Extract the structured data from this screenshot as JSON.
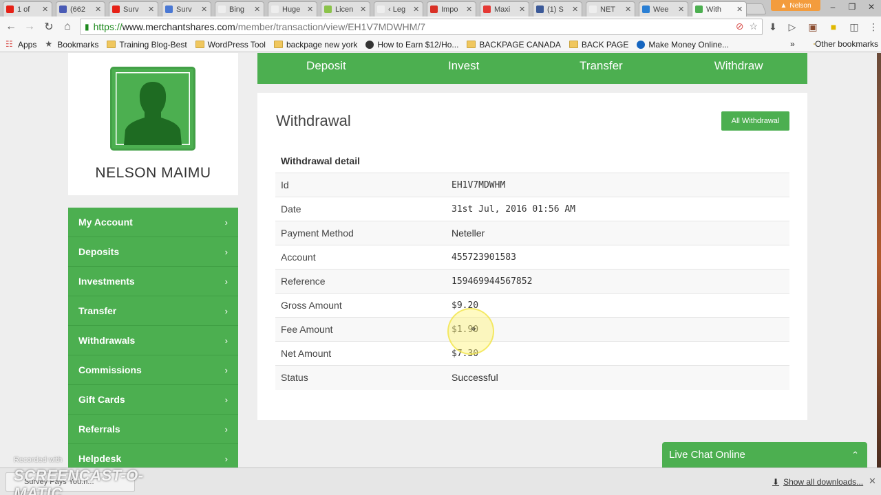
{
  "browser": {
    "tabs": [
      {
        "label": "1 of",
        "color": "#e62117"
      },
      {
        "label": "(662",
        "color": "#4a5bb5"
      },
      {
        "label": "Surv",
        "color": "#e62117"
      },
      {
        "label": "Surv",
        "color": "#4a78d4"
      },
      {
        "label": "Bing",
        "color": "#eeeeee"
      },
      {
        "label": "Huge",
        "color": "#eeeeee"
      },
      {
        "label": "Licen",
        "color": "#8bc34a"
      },
      {
        "label": "‹ Leg",
        "color": "#eeeeee"
      },
      {
        "label": "Impo",
        "color": "#d93025"
      },
      {
        "label": "Maxi",
        "color": "#e53935"
      },
      {
        "label": "(1) S",
        "color": "#3b5998"
      },
      {
        "label": "NET",
        "color": "#eeeeee"
      },
      {
        "label": "Wee",
        "color": "#2a7fd4"
      },
      {
        "label": "With",
        "color": "#4caf50"
      }
    ],
    "profile_name": "Nelson",
    "url": {
      "scheme": "https://",
      "host": "www.merchantshares.com",
      "path": "/member/transaction/view/EH1V7MDWHM/7"
    },
    "bookmarks": [
      {
        "label": "Apps",
        "icon": "apps-grid-icon"
      },
      {
        "label": "Bookmarks",
        "icon": "star-icon"
      },
      {
        "label": "Training Blog-Best",
        "icon": "folder-icon"
      },
      {
        "label": "WordPress Tool",
        "icon": "folder-icon"
      },
      {
        "label": "backpage new york",
        "icon": "folder-icon"
      },
      {
        "label": "How to Earn $12/Ho...",
        "icon": "site-icon"
      },
      {
        "label": "BACKPAGE CANADA",
        "icon": "folder-icon"
      },
      {
        "label": "BACK PAGE",
        "icon": "folder-icon"
      },
      {
        "label": "Make Money Online...",
        "icon": "site-icon"
      }
    ],
    "other_bookmarks": "Other bookmarks"
  },
  "profile": {
    "name": "NELSON MAIMU"
  },
  "sidenav": [
    "My Account",
    "Deposits",
    "Investments",
    "Transfer",
    "Withdrawals",
    "Commissions",
    "Gift Cards",
    "Referrals",
    "Helpdesk"
  ],
  "topmenu": [
    "Deposit",
    "Invest",
    "Transfer",
    "Withdraw"
  ],
  "withdrawal": {
    "title": "Withdrawal",
    "all_button": "All Withdrawal",
    "detail_heading": "Withdrawal detail",
    "rows": [
      {
        "label": "Id",
        "value": "EH1V7MDWHM"
      },
      {
        "label": "Date",
        "value": "31st Jul, 2016 01:56 AM"
      },
      {
        "label": "Payment Method",
        "value": "Neteller"
      },
      {
        "label": "Account",
        "value": "455723901583"
      },
      {
        "label": "Reference",
        "value": "159469944567852"
      },
      {
        "label": "Gross Amount",
        "value": "$9.20"
      },
      {
        "label": "Fee Amount",
        "value": "$1.90"
      },
      {
        "label": "Net Amount",
        "value": "$7.30"
      },
      {
        "label": "Status",
        "value": "Successful"
      }
    ]
  },
  "livechat": {
    "label": "Live Chat Online"
  },
  "downloads": {
    "item": "Survey Pays You.h...",
    "show_all": "Show all downloads..."
  },
  "watermark": {
    "small": "Recorded with",
    "big": "SCREENCAST-O-MATIC"
  },
  "colors": {
    "accent_green": "#4caf50",
    "url_green": "#1e8a1e"
  }
}
